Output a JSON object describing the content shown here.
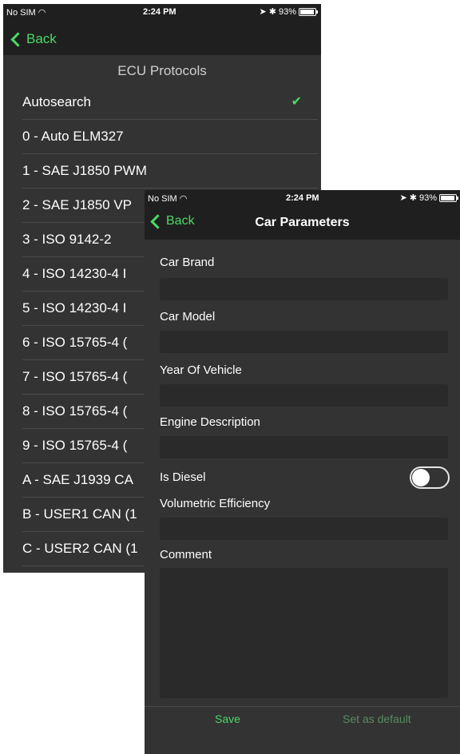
{
  "ecu_screen": {
    "status": {
      "carrier": "No SIM",
      "time": "2:24 PM",
      "battery": "93%",
      "battery_level": 0.93
    },
    "back_label": "Back",
    "title": "ECU Protocols",
    "items": [
      "Autosearch",
      "0 - Auto ELM327",
      "1 - SAE J1850 PWM",
      "2 - SAE J1850 VP",
      "3 - ISO 9142-2",
      "4 - ISO 14230-4 I",
      "5 - ISO 14230-4 I",
      "6 - ISO 15765-4 (",
      "7 - ISO 15765-4 (",
      "8 - ISO 15765-4 (",
      "9 - ISO 15765-4 (",
      "A - SAE J1939 CA",
      "B - USER1 CAN (1",
      "C - USER2 CAN (1"
    ],
    "selected_index": 0
  },
  "car_screen": {
    "status": {
      "carrier": "No SIM",
      "time": "2:24 PM",
      "battery": "93%",
      "battery_level": 0.93
    },
    "back_label": "Back",
    "title": "Car Parameters",
    "fields": {
      "brand_label": "Car Brand",
      "brand_value": "",
      "model_label": "Car Model",
      "model_value": "",
      "year_label": "Year Of Vehicle",
      "year_value": "",
      "engine_label": "Engine Description",
      "engine_value": "",
      "diesel_label": "Is Diesel",
      "diesel_on": false,
      "ve_label": "Volumetric Efficiency",
      "ve_value": "",
      "comment_label": "Comment",
      "comment_value": ""
    },
    "save_label": "Save",
    "default_label": "Set as default"
  },
  "colors": {
    "accent": "#4cd964",
    "disabled": "#5a8a63",
    "background": "#333333",
    "bar": "#1f1f1f"
  }
}
